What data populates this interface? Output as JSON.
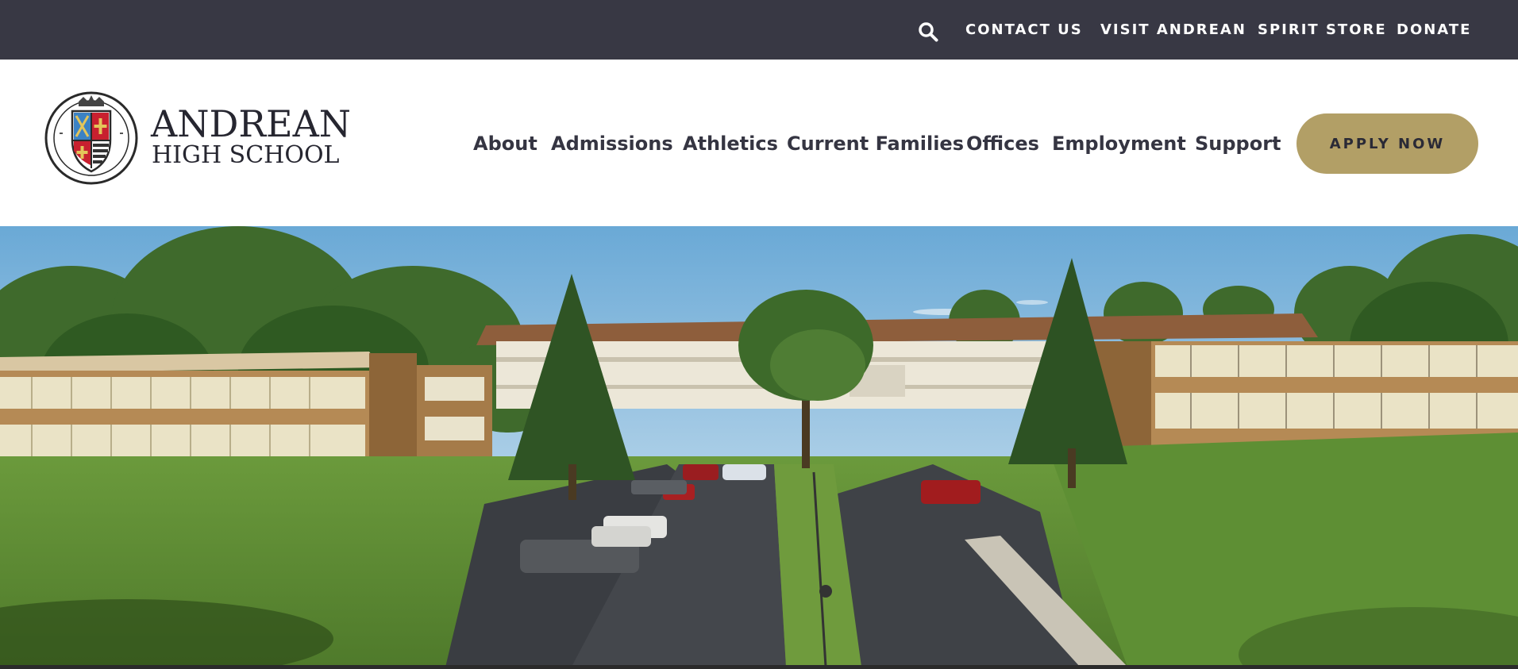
{
  "utility_nav": {
    "search_icon": "search-icon",
    "links": [
      "CONTACT US",
      "VISIT ANDREAN",
      "SPIRIT STORE",
      "DONATE"
    ]
  },
  "brand": {
    "name_line1": "ANDREAN",
    "name_line2": "HIGH SCHOOL",
    "seal_icon": "school-crest-icon"
  },
  "main_nav": {
    "items": [
      "About",
      "Admissions",
      "Athletics",
      "Current Families",
      "Offices",
      "Employment",
      "Support"
    ],
    "cta": "APPLY NOW"
  },
  "hero": {
    "image": "aerial-campus-photo"
  },
  "colors": {
    "utility_bar": "#383844",
    "nav_text": "#353542",
    "cta_gold": "#b29f66",
    "crest_red": "#c8202f",
    "crest_blue": "#3b82c4"
  }
}
